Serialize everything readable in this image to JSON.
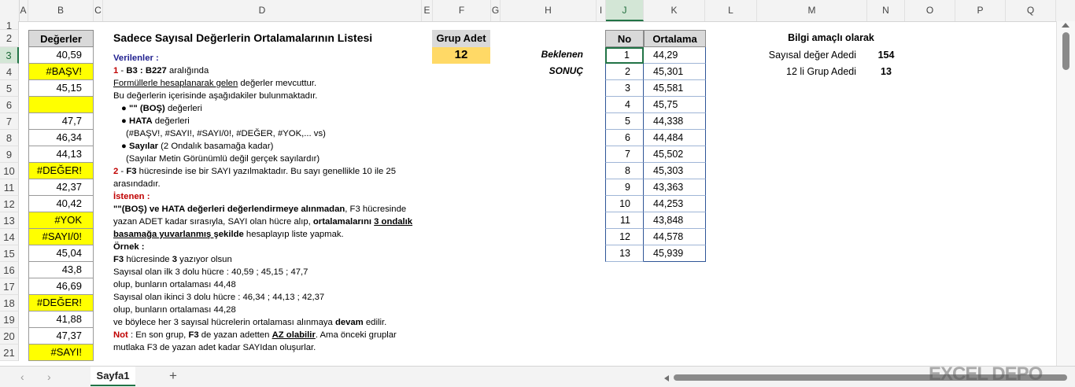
{
  "columns": [
    "A",
    "B",
    "C",
    "D",
    "E",
    "F",
    "G",
    "H",
    "I",
    "J",
    "K",
    "L",
    "M",
    "N",
    "O",
    "P",
    "Q"
  ],
  "rows": [
    "1",
    "2",
    "3",
    "4",
    "5",
    "6",
    "7",
    "8",
    "9",
    "10",
    "11",
    "12",
    "13",
    "14",
    "15",
    "16",
    "17",
    "18",
    "19",
    "20",
    "21"
  ],
  "b_header": "Değerler",
  "b_values": [
    {
      "text": "40,59",
      "yellow": false
    },
    {
      "text": "#BAŞV!",
      "yellow": true
    },
    {
      "text": "45,15",
      "yellow": false
    },
    {
      "text": "",
      "yellow": true
    },
    {
      "text": "47,7",
      "yellow": false
    },
    {
      "text": "46,34",
      "yellow": false
    },
    {
      "text": "44,13",
      "yellow": false
    },
    {
      "text": "#DEĞER!",
      "yellow": true
    },
    {
      "text": "42,37",
      "yellow": false
    },
    {
      "text": "40,42",
      "yellow": false
    },
    {
      "text": "#YOK",
      "yellow": true
    },
    {
      "text": "#SAYI/0!",
      "yellow": true
    },
    {
      "text": "45,04",
      "yellow": false
    },
    {
      "text": "43,8",
      "yellow": false
    },
    {
      "text": "46,69",
      "yellow": false
    },
    {
      "text": "#DEĞER!",
      "yellow": true
    },
    {
      "text": "41,88",
      "yellow": false
    },
    {
      "text": "47,37",
      "yellow": false
    },
    {
      "text": "#SAYI!",
      "yellow": true
    }
  ],
  "title": "Sadece Sayısal Değerlerin Ortalamalarının Listesi",
  "desc": {
    "l1": "Verilenler :",
    "l2a": "1",
    "l2b": " - ",
    "l2c": "B3 : B227",
    "l2d": " aralığında",
    "l3a": "Formüllerle hesaplanarak gelen",
    "l3b": " değerler mevcuttur.",
    "l4": "Bu değerlerin içerisinde aşağıdakiler bulunmaktadır.",
    "l5a": "● ",
    "l5b": "\"\" (BOŞ)",
    "l5c": " değerleri",
    "l6a": "● ",
    "l6b": "HATA",
    "l6c": " değerleri",
    "l7": "(#BAŞV!, #SAYI!, #SAYI/0!, #DEĞER, #YOK,... vs)",
    "l8a": "● ",
    "l8b": "Sayılar",
    "l8c": " (2 Ondalık basamağa kadar)",
    "l9": "(Sayılar Metin Görünümlü değil gerçek sayılardır)",
    "l10a": "2",
    "l10b": " - ",
    "l10c": "F3",
    "l10d": " hücresinde ise bir SAYI yazılmaktadır. Bu sayı genellikle 10 ile 25",
    "l11": "arasındadır.",
    "l12": "İstenen :",
    "l13a": "\"\"(BOŞ) ve HATA değerleri değerlendirmeye alınmadan",
    "l13b": ", F3 hücresinde",
    "l14a": "yazan ADET kadar sırasıyla, SAYI olan hücre alıp, ",
    "l14b": "ortalamalarını",
    "l14c": " ",
    "l14d": "3 ondalık",
    "l15a": "basamağa yuvarlanmış ",
    "l15b": " şekilde",
    "l15c": "  hesaplayıp liste yapmak.",
    "l16": "Örnek :",
    "l17a": "F3",
    "l17b": " hücresinde ",
    "l17c": "3",
    "l17d": " yazıyor olsun",
    "l18": "Sayısal olan ilk 3 dolu hücre : 40,59 ; 45,15 ; 47,7",
    "l19": "olup, bunların ortalaması  44,48",
    "l20": "Sayısal olan ikinci 3 dolu hücre : 46,34 ; 44,13 ; 42,37",
    "l21": "olup, bunların ortalaması  44,28",
    "l22a": "ve böylece her 3 sayısal hücrelerin ortalaması alınmaya ",
    "l22b": "devam",
    "l22c": " edilir.",
    "l23a": "Not",
    "l23b": " : En son grup, ",
    "l23c": "F3",
    "l23d": " de yazan adetten ",
    "l23e": "AZ olabilir",
    "l23f": ". Ama önceki gruplar",
    "l24": "mutlaka F3 de yazan adet kadar SAYIdan oluşurlar."
  },
  "grup": {
    "label": "Grup Adet",
    "value": "12"
  },
  "beklenen": "Beklenen",
  "sonuc": "SONUÇ",
  "table": {
    "h_no": "No",
    "h_ort": "Ortalama",
    "rows": [
      {
        "no": "1",
        "val": "44,29"
      },
      {
        "no": "2",
        "val": "45,301"
      },
      {
        "no": "3",
        "val": "45,581"
      },
      {
        "no": "4",
        "val": "45,75"
      },
      {
        "no": "5",
        "val": "44,338"
      },
      {
        "no": "6",
        "val": "44,484"
      },
      {
        "no": "7",
        "val": "45,502"
      },
      {
        "no": "8",
        "val": "45,303"
      },
      {
        "no": "9",
        "val": "43,363"
      },
      {
        "no": "10",
        "val": "44,253"
      },
      {
        "no": "11",
        "val": "43,848"
      },
      {
        "no": "12",
        "val": "44,578"
      },
      {
        "no": "13",
        "val": "45,939"
      }
    ]
  },
  "info": {
    "title": "Bilgi amaçlı olarak",
    "l1": "Sayısal değer Adedi",
    "v1": "154",
    "l2": "12 li Grup Adedi",
    "v2": "13"
  },
  "sheet_tab": "Sayfa1",
  "add_sheet": "+",
  "watermark": "EXCEL DEPO"
}
